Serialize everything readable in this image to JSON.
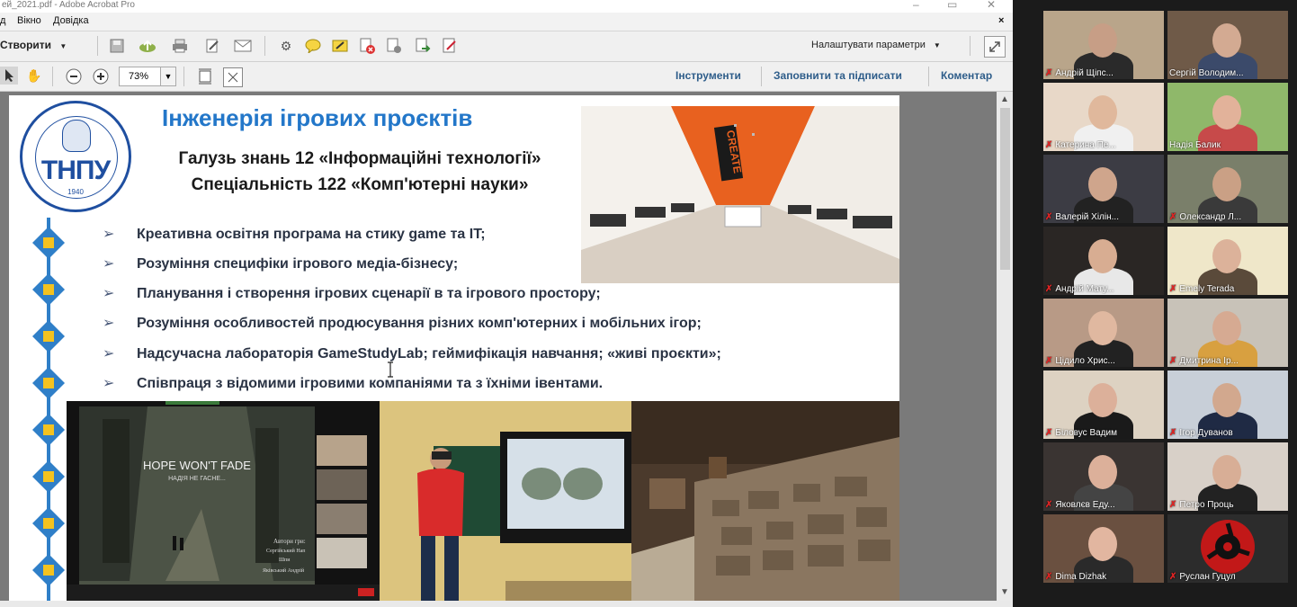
{
  "window": {
    "title": "ей_2021.pdf - Adobe Acrobat Pro",
    "close_doc": "×"
  },
  "menu": [
    "д",
    "Вікно",
    "Довідка"
  ],
  "toolbar": {
    "create_label": "Створити",
    "settings_label": "Налаштувати параметри",
    "zoom_value": "73%",
    "tabs": [
      "Інструменти",
      "Заповнити та підписати",
      "Коментар"
    ]
  },
  "slide": {
    "logo_text": "ТНПУ",
    "logo_year": "1940",
    "title": "Інженерія ігрових проєктів",
    "subtitle1": "Галузь знань 12 «Інформаційні технології»",
    "subtitle2": "Спеціальність 122 «Комп'ютерні науки»",
    "bullet_marker": "➢",
    "bullets": [
      "Креативна освітня програма на стику game та IT;",
      "Розуміння специфіки ігрового медіа-бізнесу;",
      "Планування і створення ігрових сценарії в та ігрового простору;",
      "Розуміння особливостей продюсування різних комп'ютерних і мобільних ігор;",
      "Надсучасна лабораторія  GameStudyLab;  геймифікація навчання; «живі проєкти»;",
      "Співпраця з відомими ігровими компаніями та з їхніми івентами."
    ],
    "photo_word": "CREATE",
    "game_title": "HOPE WON'T FADE",
    "game_subtitle": "НАДІЯ НЕ ГАСНЕ...",
    "credits": [
      "Автори гри:",
      "Сергійський Нап",
      "Шпи",
      "Яківський Андрій"
    ]
  },
  "participants": [
    {
      "name": "Андрій Щіпс...",
      "muted": true
    },
    {
      "name": "Сергій Володим...",
      "muted": false
    },
    {
      "name": "Катерина Пе...",
      "muted": true
    },
    {
      "name": "Надія Балик",
      "muted": false,
      "active": true
    },
    {
      "name": "Валерій Хілін...",
      "muted": true
    },
    {
      "name": "Олександр Л...",
      "muted": true
    },
    {
      "name": "Андрій Мату...",
      "muted": true
    },
    {
      "name": "Emely Terada",
      "muted": true
    },
    {
      "name": "Цідило Хрис...",
      "muted": true
    },
    {
      "name": "Дмитрина Ір...",
      "muted": true
    },
    {
      "name": "Біловус Вадим",
      "muted": true
    },
    {
      "name": "Ігор Дуванов",
      "muted": true
    },
    {
      "name": "Яковлєв Еду...",
      "muted": true
    },
    {
      "name": "Петро Проць",
      "muted": true
    },
    {
      "name": "Dima Dizhak",
      "muted": true
    },
    {
      "name": "Руслан Гуцул",
      "muted": true
    }
  ],
  "mic_glyph": "✗"
}
